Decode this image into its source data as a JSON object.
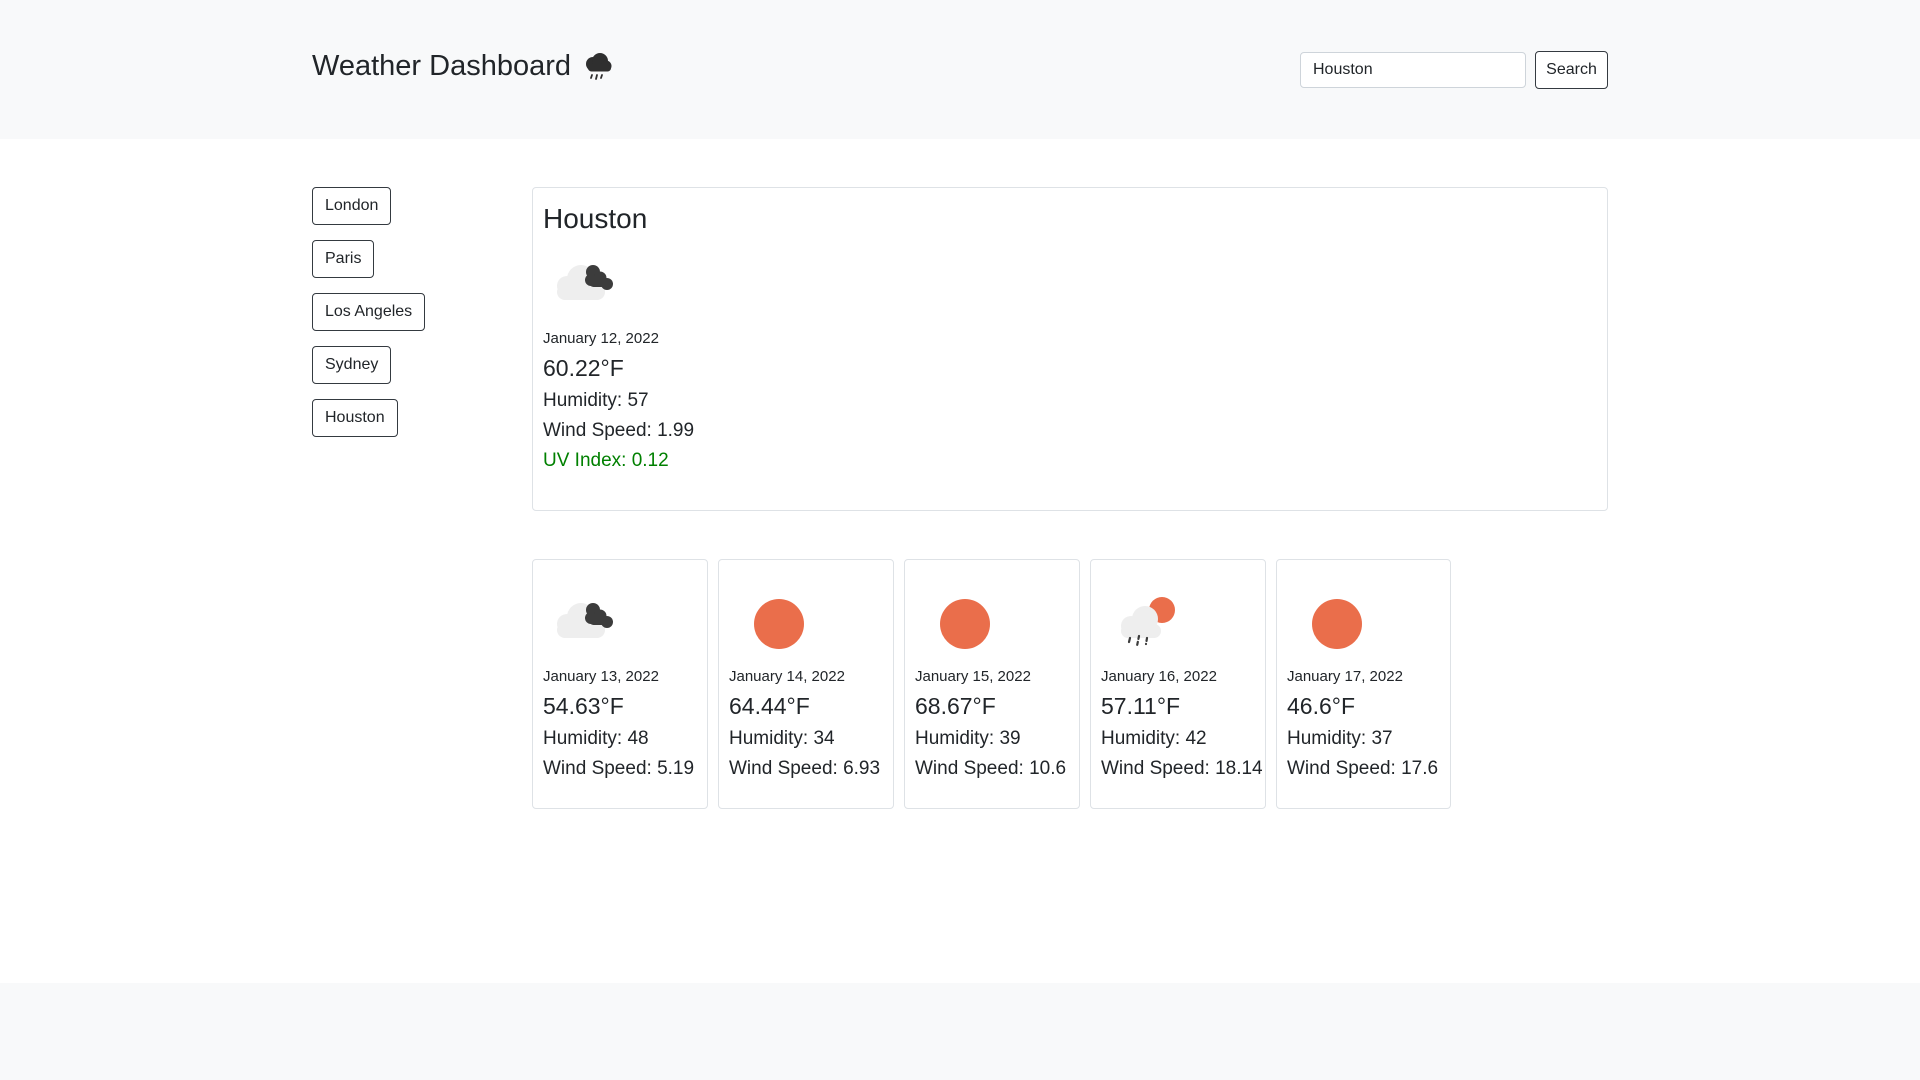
{
  "header": {
    "title": "Weather Dashboard",
    "title_icon": "rain-cloud-icon",
    "search": {
      "value": "Houston",
      "placeholder": ""
    },
    "search_button": "Search"
  },
  "sidebar": {
    "cities": [
      {
        "label": "London"
      },
      {
        "label": "Paris"
      },
      {
        "label": "Los Angeles"
      },
      {
        "label": "Sydney"
      },
      {
        "label": "Houston"
      }
    ]
  },
  "current": {
    "city": "Houston",
    "icon": "broken-clouds-icon",
    "date": "January 12, 2022",
    "temp": "60.22°F",
    "humidity": "Humidity: 57",
    "wind": "Wind Speed: 1.99",
    "uv": "UV Index: 0.12",
    "uv_color": "#008000"
  },
  "forecast": [
    {
      "icon": "broken-clouds-icon",
      "date": "January 13, 2022",
      "temp": "54.63°F",
      "humidity": "Humidity: 48",
      "wind": "Wind Speed: 5.19"
    },
    {
      "icon": "clear-sun-icon",
      "date": "January 14, 2022",
      "temp": "64.44°F",
      "humidity": "Humidity: 34",
      "wind": "Wind Speed: 6.93"
    },
    {
      "icon": "clear-sun-icon",
      "date": "January 15, 2022",
      "temp": "68.67°F",
      "humidity": "Humidity: 39",
      "wind": "Wind Speed: 10.6"
    },
    {
      "icon": "sun-rain-icon",
      "date": "January 16, 2022",
      "temp": "57.11°F",
      "humidity": "Humidity: 42",
      "wind": "Wind Speed: 18.14"
    },
    {
      "icon": "clear-sun-icon",
      "date": "January 17, 2022",
      "temp": "46.6°F",
      "humidity": "Humidity: 37",
      "wind": "Wind Speed: 17.6"
    }
  ],
  "colors": {
    "header_bg": "#f8f9fa",
    "sun": "#ea6e4b",
    "cloud_dark": "#3c3c3c",
    "cloud_light": "#eeeeee"
  }
}
